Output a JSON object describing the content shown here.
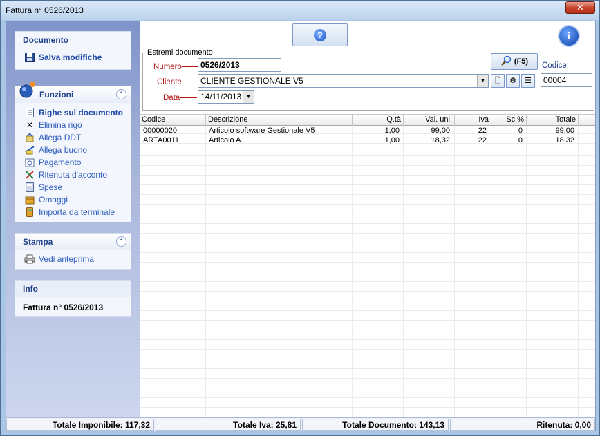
{
  "window": {
    "title": "Fattura n° 0526/2013",
    "close_label": "✕"
  },
  "sidebar": {
    "documento": {
      "title": "Documento",
      "items": [
        {
          "label": "Salva modifiche",
          "icon": "floppy-icon"
        }
      ]
    },
    "funzioni": {
      "title": "Funzioni",
      "items": [
        {
          "label": "Righe sul documento",
          "icon": "document-icon"
        },
        {
          "label": "Elimina rigo",
          "icon": "delete-x-icon"
        },
        {
          "label": "Allega DDT",
          "icon": "attach-icon"
        },
        {
          "label": "Allega buono",
          "icon": "voucher-icon"
        },
        {
          "label": "Pagamento",
          "icon": "payment-icon"
        },
        {
          "label": "Ritenuta d'acconto",
          "icon": "tools-icon"
        },
        {
          "label": "Spese",
          "icon": "calculator-icon"
        },
        {
          "label": "Omaggi",
          "icon": "gift-icon"
        },
        {
          "label": "Importa da terminale",
          "icon": "terminal-icon"
        }
      ]
    },
    "stampa": {
      "title": "Stampa",
      "items": [
        {
          "label": "Vedi anteprima",
          "icon": "printer-icon"
        }
      ]
    },
    "info": {
      "title": "Info",
      "text": "Fattura n° 0526/2013"
    }
  },
  "header": {
    "help_glyph": "?",
    "info_glyph": "i",
    "legend": "Estremi documento",
    "numero_label": "Numero",
    "numero_value": "0526/2013",
    "cliente_label": "Cliente",
    "cliente_value": "CLIENTE GESTIONALE V5",
    "data_label": "Data",
    "data_value": "14/11/2013",
    "search_label": "(F5)",
    "codice_label": "Codice:",
    "codice_value": "00004"
  },
  "grid": {
    "columns": [
      "Codice",
      "Descrizione",
      "Q.tà",
      "Val. uni.",
      "Iva",
      "Sc %",
      "Totale"
    ],
    "rows": [
      [
        "00000020",
        "Articolo software Gestionale V5",
        "1,00",
        "99,00",
        "22",
        "0",
        "99,00"
      ],
      [
        "ARTA0011",
        "Articolo A",
        "1,00",
        "18,32",
        "22",
        "0",
        "18,32"
      ]
    ]
  },
  "status": {
    "imponibile": "Totale Imponibile: 117,32",
    "iva": "Totale Iva: 25,81",
    "documento": "Totale Documento: 143,13",
    "ritenuta": "Ritenuta: 0,00"
  },
  "colors": {
    "accent": "#2d5cbf",
    "label_red": "#b01616",
    "sidebar_top": "#7f93c9"
  }
}
